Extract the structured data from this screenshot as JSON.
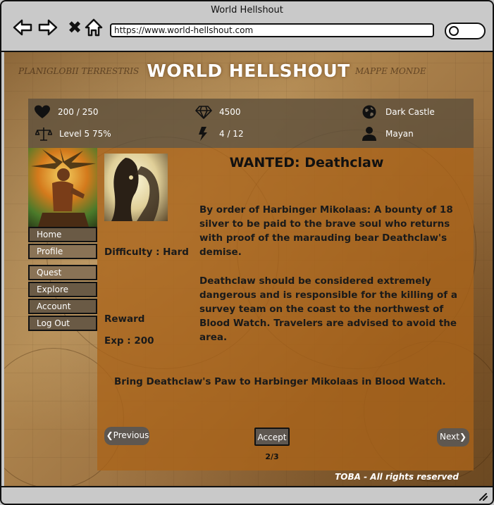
{
  "browser": {
    "title": "World Hellshout",
    "url": "https://www.world-hellshout.com"
  },
  "page": {
    "site_title": "WORLD HELLSHOUT",
    "map_captions": [
      "PLANIGLOBII TERRESTRIS",
      "MAPPE MONDE"
    ]
  },
  "stats": {
    "health": "200 / 250",
    "gems": "4500",
    "location": "Dark Castle",
    "level": "Level 5  75%",
    "energy": "4 / 12",
    "player": "Mayan"
  },
  "nav": {
    "items": [
      "Home",
      "Profile",
      "Quest",
      "Explore",
      "Account",
      "Log Out"
    ]
  },
  "quest": {
    "title": "WANTED: Deathclaw",
    "description_1": "By order of Harbinger Mikolaas: A bounty of 18 silver to be paid to the brave soul who returns with proof of the marauding bear Deathclaw's demise.",
    "description_2": "Deathclaw should be considered extremely dangerous and is responsible for the killing of a survey team on the coast to the northwest of Blood Watch. Travelers are advised to avoid the area.",
    "difficulty": "Difficulty : Hard",
    "reward_label": "Reward",
    "exp": "Exp : 200",
    "objective": "Bring Deathclaw's Paw to Harbinger Mikolaas in Blood Watch."
  },
  "controls": {
    "previous": "Previous",
    "accept": "Accept",
    "next": "Next",
    "page_indicator": "2/3"
  },
  "footer": {
    "credit": "TOBA  - All rights reserved"
  },
  "icons": {
    "health": "heart-icon",
    "gems": "diamond-icon",
    "location": "globe-icon",
    "level": "scales-icon",
    "energy": "lightning-icon",
    "player": "user-icon"
  }
}
